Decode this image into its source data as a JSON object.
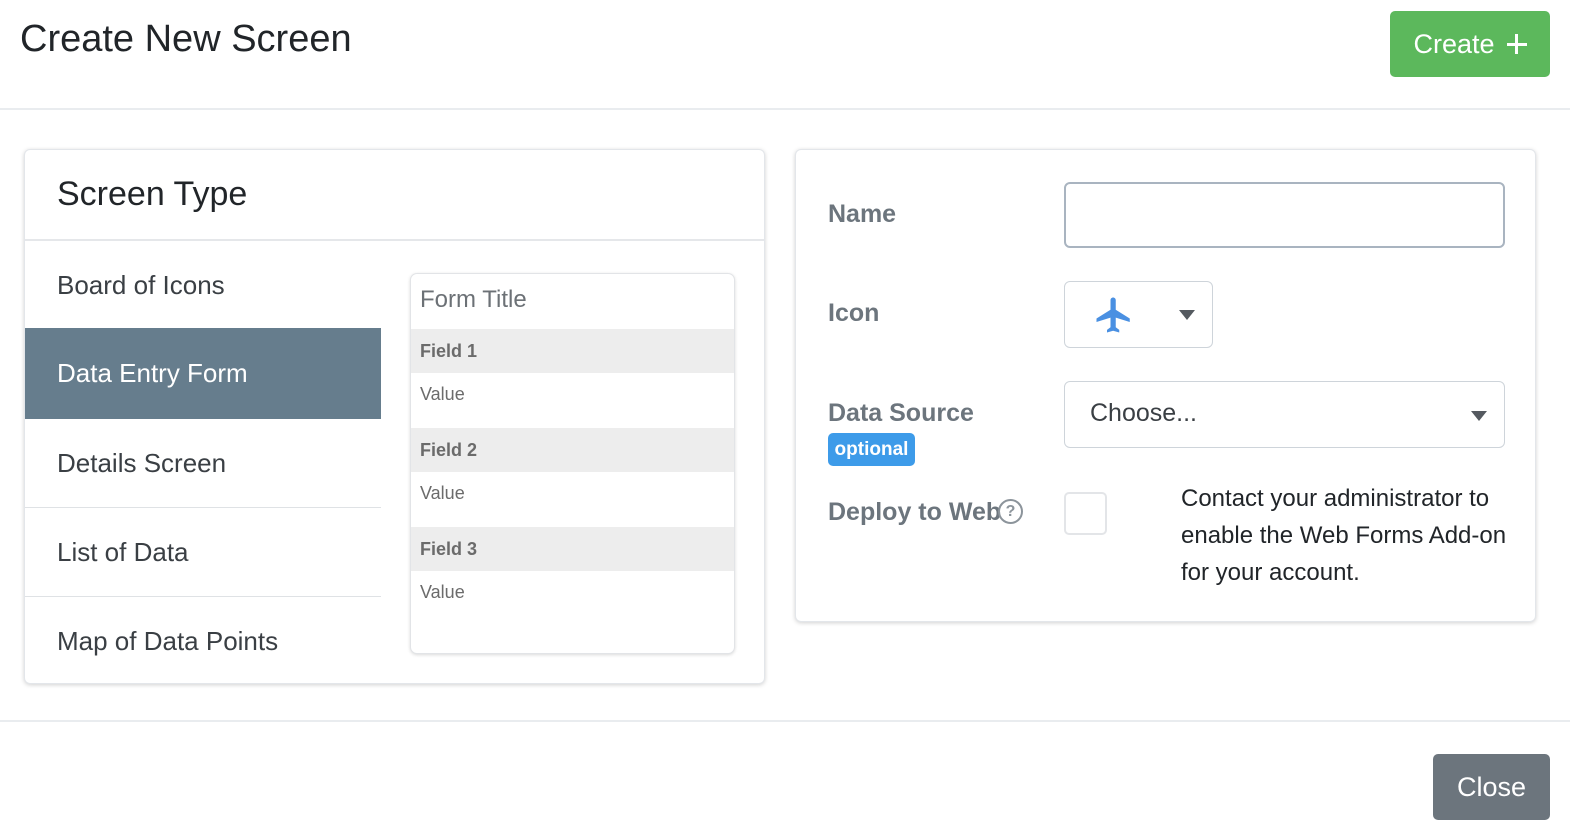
{
  "header": {
    "title": "Create New Screen",
    "create_label": "Create",
    "create_icon": "plus-icon",
    "create_color": "#5cb85c"
  },
  "screen_type": {
    "heading": "Screen Type",
    "items": [
      {
        "label": "Board of Icons",
        "active": false
      },
      {
        "label": "Data Entry Form",
        "active": true
      },
      {
        "label": "Details Screen",
        "active": false
      },
      {
        "label": "List of Data",
        "active": false
      },
      {
        "label": "Map of Data Points",
        "active": false
      }
    ],
    "active_color": "#667d8d"
  },
  "preview": {
    "form_title": "Form Title",
    "fields": [
      {
        "label": "Field 1",
        "value": "Value"
      },
      {
        "label": "Field 2",
        "value": "Value"
      },
      {
        "label": "Field 3",
        "value": "Value"
      }
    ]
  },
  "form": {
    "name_label": "Name",
    "name_value": "",
    "icon_label": "Icon",
    "icon_value": "airplane-icon",
    "icon_color": "#4a90e2",
    "data_source_label": "Data Source",
    "data_source_badge": "optional",
    "data_source_value": "Choose...",
    "deploy_label": "Deploy to Web",
    "deploy_help_icon": "question-circle-icon",
    "deploy_checked": false,
    "deploy_note": "Contact your administrator to enable the Web Forms Add-on for your account."
  },
  "footer": {
    "close_label": "Close"
  }
}
